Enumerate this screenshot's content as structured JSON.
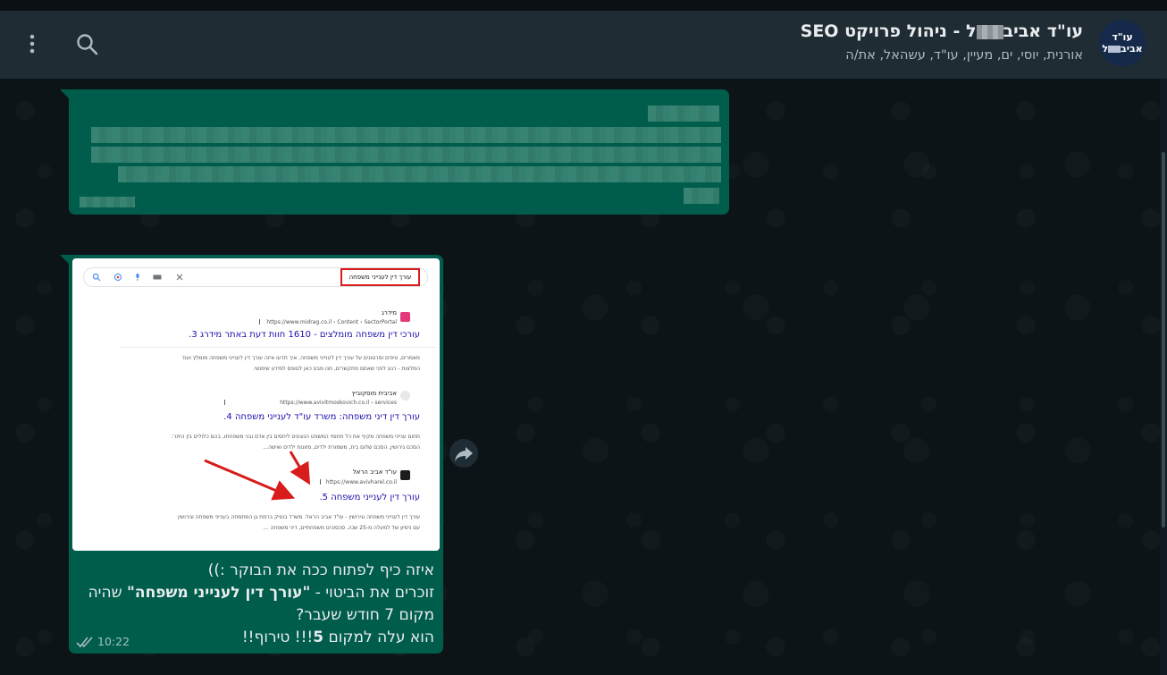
{
  "header": {
    "title_prefix": "עו\"ד אביב",
    "title_suffix": "ל - ניהול פרויקט SEO",
    "subtitle": "אורנית, יוסי, ים, מעיין, עו\"ד, עשהאל, את/ה",
    "avatar_line1": "עו\"ד",
    "avatar_line2_prefix": "אביב",
    "avatar_line2_suffix": "ל"
  },
  "icons": {
    "menu": "vertical-dots-icon",
    "search": "search-icon",
    "forward": "forward-arrow-icon",
    "read_receipt": "double-check-icon"
  },
  "messages": [
    {
      "type": "text-redacted"
    },
    {
      "type": "image-with-caption",
      "screenshot": {
        "query": "עורך דין לענייני משפחה",
        "results": [
          {
            "site": "מידרג",
            "url": "https://www.midrag.co.il › Content › SectorPortal",
            "title": "עורכי דין משפחה מומלצים - 1610 חוות דעת באתר מידרג 3.",
            "snippet_1": "מאמרים, טיפים וסרטונים על עורך דין לענייני משפחה. איך תדעו איזה עורך דין לענייני משפחה מומלץ ועוד",
            "snippet_2": "המלצות - רגע לפני שאתם מתקשרים, תנו מבט כאן לטופס למידע שימושי."
          },
          {
            "site": "אביבית מוסקוביץ",
            "url": "https://www.avivitmoskovich.co.il › services",
            "title": "עורך דין דיני משפחה: משרד עו\"ד לענייני משפחה 4.",
            "snippet_1": "תחום ענייני משפחה מקיף את כל תחומי המשפט הנוגעים ליחסים בין אדם ובני משפחתו, בהם כלולים בין היתר:",
            "snippet_2": "הסכם גירושין, הסכם שלום בית, משמורת ילדים, מזונות ילדים ואישה..."
          },
          {
            "site": "עו\"ד אביב הראל",
            "url": "https://www.avivharel.co.il",
            "title": "עורך דין לענייני משפחה 5.",
            "snippet_1": "עורך דין לענייני משפחה וגירושין - עו\"ד אביב הראל. משרד בוטיק ברמת גן המתמחה בענייני משפחה וגירושין",
            "snippet_2": "עם ניסיון של למעלה מ-25 שנה. סכסוכים משפחתיים, דיני משפחה ..."
          }
        ]
      },
      "caption": {
        "line1": "איזה כיף לפתוח ככה את הבוקר :))",
        "line2_prefix": "זוכרים את הביטוי - ",
        "line2_bold": "\"עורך דין לענייני משפחה\"",
        "line2_suffix": " שהיה",
        "line3": "מקום 7 חודש שעבר?",
        "line4_prefix": "הוא עלה למקום ",
        "line4_bold": "5",
        "line4_suffix": "!!! טירוף!!"
      },
      "time": "10:22",
      "status": "read"
    }
  ],
  "colors": {
    "header_bg": "#202c33",
    "chat_bg": "#0d1418",
    "outgoing_bubble": "#005c4b",
    "text_primary": "#e9edef",
    "text_secondary": "#aebac1",
    "read_tick": "#aebac1",
    "highlight_red": "#d81b1b"
  }
}
